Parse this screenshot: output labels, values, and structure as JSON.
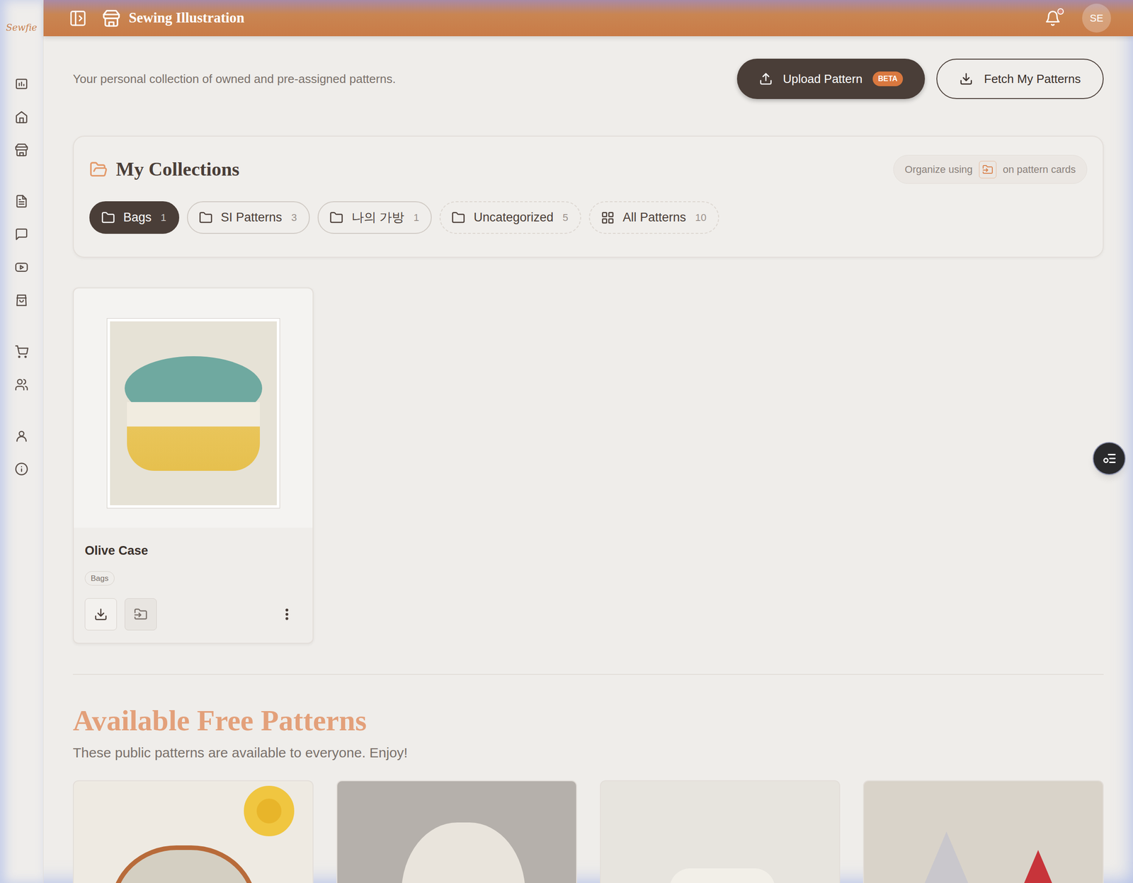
{
  "sidebar": {
    "logo": "Sewfie"
  },
  "header": {
    "title": "Sewing Illustration",
    "has_notification": true,
    "avatar": "SE"
  },
  "intro": {
    "text": "Your personal collection of owned and pre-assigned patterns."
  },
  "actions": {
    "upload": {
      "label": "Upload Pattern",
      "badge": "BETA"
    },
    "fetch": {
      "label": "Fetch My Patterns"
    }
  },
  "collections": {
    "title": "My Collections",
    "hint": {
      "before": "Organize using",
      "after": "on pattern cards"
    },
    "items": [
      {
        "label": "Bags",
        "count": "1",
        "selected": true,
        "kind": "folder"
      },
      {
        "label": "SI Patterns",
        "count": "3",
        "selected": false,
        "kind": "folder"
      },
      {
        "label": "나의 가방",
        "count": "1",
        "selected": false,
        "kind": "folder"
      },
      {
        "label": "Uncategorized",
        "count": "5",
        "selected": false,
        "kind": "loose"
      },
      {
        "label": "All Patterns",
        "count": "10",
        "selected": false,
        "kind": "all"
      }
    ]
  },
  "patterns": [
    {
      "title": "Olive Case",
      "tags": [
        "Bags"
      ]
    }
  ],
  "free_patterns": {
    "title": "Available Free Patterns",
    "subtitle": "These public patterns are available to everyone. Enjoy!"
  }
}
